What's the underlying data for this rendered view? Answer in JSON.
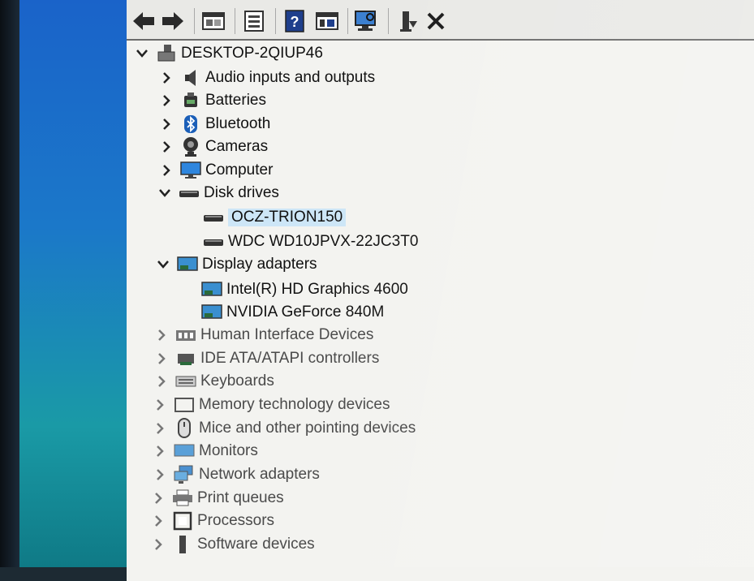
{
  "toolbar": {
    "buttons": [
      "back-icon",
      "forward-icon",
      "properties-window-icon",
      "update-driver-icon",
      "help-icon",
      "show-hidden-icon",
      "scan-hardware-icon",
      "add-legacy-icon",
      "uninstall-icon"
    ]
  },
  "tree": {
    "root": "DESKTOP-2QIUP46",
    "categories": [
      {
        "label": "Audio inputs and outputs",
        "icon": "speaker-icon",
        "expanded": false
      },
      {
        "label": "Batteries",
        "icon": "battery-icon",
        "expanded": false
      },
      {
        "label": "Bluetooth",
        "icon": "bluetooth-icon",
        "expanded": false
      },
      {
        "label": "Cameras",
        "icon": "camera-icon",
        "expanded": false
      },
      {
        "label": "Computer",
        "icon": "monitor-icon",
        "expanded": false
      },
      {
        "label": "Disk drives",
        "icon": "disk-drive-icon",
        "expanded": true,
        "children": [
          {
            "label": "OCZ-TRION150",
            "selected": true
          },
          {
            "label": "WDC WD10JPVX-22JC3T0",
            "selected": false
          }
        ]
      },
      {
        "label": "Display adapters",
        "icon": "display-adapter-icon",
        "expanded": true,
        "children": [
          {
            "label": "Intel(R) HD Graphics 4600"
          },
          {
            "label": "NVIDIA GeForce 840M"
          }
        ]
      },
      {
        "label": "Human Interface Devices",
        "icon": "hid-icon",
        "expanded": false
      },
      {
        "label": "IDE ATA/ATAPI controllers",
        "icon": "ide-controller-icon",
        "expanded": false
      },
      {
        "label": "Keyboards",
        "icon": "keyboard-icon",
        "expanded": false
      },
      {
        "label": "Memory technology devices",
        "icon": "memory-icon",
        "expanded": false
      },
      {
        "label": "Mice and other pointing devices",
        "icon": "mouse-icon",
        "expanded": false
      },
      {
        "label": "Monitors",
        "icon": "monitor-icon",
        "expanded": false
      },
      {
        "label": "Network adapters",
        "icon": "network-icon",
        "expanded": false
      },
      {
        "label": "Print queues",
        "icon": "printer-icon",
        "expanded": false
      },
      {
        "label": "Processors",
        "icon": "processor-icon",
        "expanded": false
      },
      {
        "label": "Software devices",
        "icon": "software-device-icon",
        "expanded": false
      }
    ]
  },
  "colors": {
    "selection": "#cde6f7",
    "accent": "#1a63c9"
  }
}
